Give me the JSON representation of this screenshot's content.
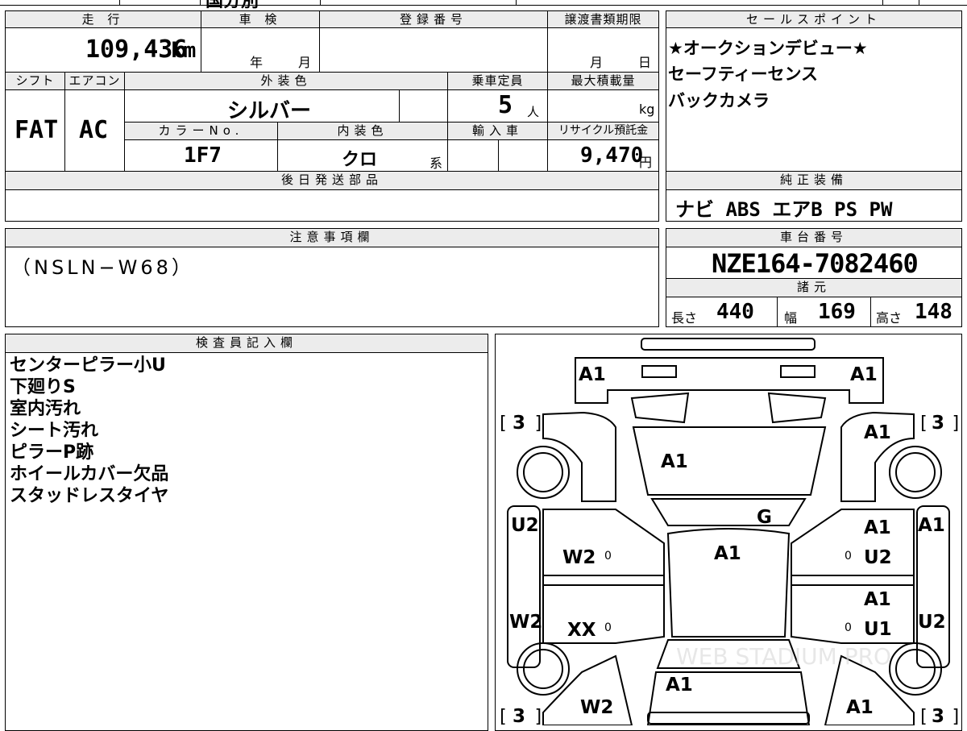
{
  "top": {
    "fragment": "国分別"
  },
  "mileage": {
    "header": "走 行",
    "value": "109,436",
    "unit": "km"
  },
  "inspection": {
    "header": "車 検",
    "year_label": "年",
    "month_label": "月"
  },
  "registration": {
    "header": "登録番号"
  },
  "transfer": {
    "header": "譲渡書類期限",
    "month_label": "月",
    "day_label": "日"
  },
  "sales_points": {
    "header": "セールスポイント",
    "lines": [
      "★オークションデビュー★",
      "セーフティーセンス",
      "バックカメラ"
    ]
  },
  "shift": {
    "header": "シフト",
    "value": "FAT"
  },
  "aircon": {
    "header": "エアコン",
    "value": "AC"
  },
  "exterior_color": {
    "header": "外装色",
    "value": "シルバー"
  },
  "capacity": {
    "header": "乗車定員",
    "value": "5",
    "unit": "人"
  },
  "max_load": {
    "header": "最大積載量",
    "unit": "kg"
  },
  "color_no": {
    "header": "カラーNo.",
    "value": "1F7"
  },
  "interior_color": {
    "header": "内装色",
    "value": "クロ",
    "suffix": "系"
  },
  "import": {
    "header": "輸入車"
  },
  "recycle": {
    "header": "リサイクル預託金",
    "value": "9,470",
    "unit": "円"
  },
  "later_parts": {
    "header": "後日発送部品"
  },
  "genuine_equipment": {
    "header": "純正装備",
    "value": "ナビ ABS エアB PS PW"
  },
  "notes": {
    "header": "注意事項欄",
    "value": "（NSLN−W68）"
  },
  "chassis": {
    "header": "車台番号",
    "value": "NZE164-7082460"
  },
  "specs": {
    "header": "諸元",
    "length_label": "長さ",
    "length": "440",
    "width_label": "幅",
    "width": "169",
    "height_label": "高さ",
    "height": "148"
  },
  "inspector": {
    "header": "検査員記入欄",
    "lines": [
      "センターピラー小U",
      "下廻りS",
      "室内汚れ",
      "シート汚れ",
      "ピラーP跡",
      "ホイールカバー欠品",
      "スタッドレスタイヤ"
    ]
  },
  "diagram": {
    "labels": {
      "front_left_corner": "A1",
      "front_right_corner": "A1",
      "hood": "A1",
      "front_right_fender": "A1",
      "windshield": "G",
      "roof": "A1",
      "front_left_door_outer": "U2",
      "front_left_door": "W2",
      "front_right_door_a": "A1",
      "front_right_door_b": "U2",
      "front_right_door_outer": "A1",
      "rear_left_door_outer": "W2",
      "rear_left_door": "XX",
      "rear_right_door_a": "A1",
      "rear_right_door_b": "U1",
      "rear_right_door_outer": "U2",
      "trunk": "A1",
      "rear_left_quarter": "W2",
      "rear_right_quarter": "A1"
    },
    "tire_brackets": {
      "fl": "3",
      "fr": "3",
      "rl": "3",
      "rr": "3"
    },
    "zeros": [
      "0",
      "0",
      "0",
      "0"
    ],
    "watermark": "WEB STADIUM PRO"
  }
}
